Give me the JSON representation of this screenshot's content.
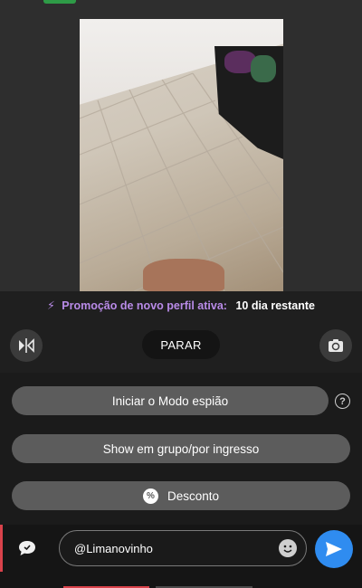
{
  "promo": {
    "bolt": "⚡",
    "label": "Promoção de novo perfil ativa:",
    "value": "10 dia restante"
  },
  "controls": {
    "stop_label": "PARAR"
  },
  "menu": {
    "spy_mode_label": "Iniciar o Modo espião",
    "help_symbol": "?",
    "group_show_label": "Show em grupo/por ingresso",
    "discount_label": "Desconto",
    "discount_icon_symbol": "%"
  },
  "chat": {
    "input_value": "@Limanovinho"
  },
  "colors": {
    "accent_purple": "#b98be8",
    "send_blue": "#2f8cf0",
    "live_green": "#2e9b47",
    "chat_red": "#d9424b"
  }
}
